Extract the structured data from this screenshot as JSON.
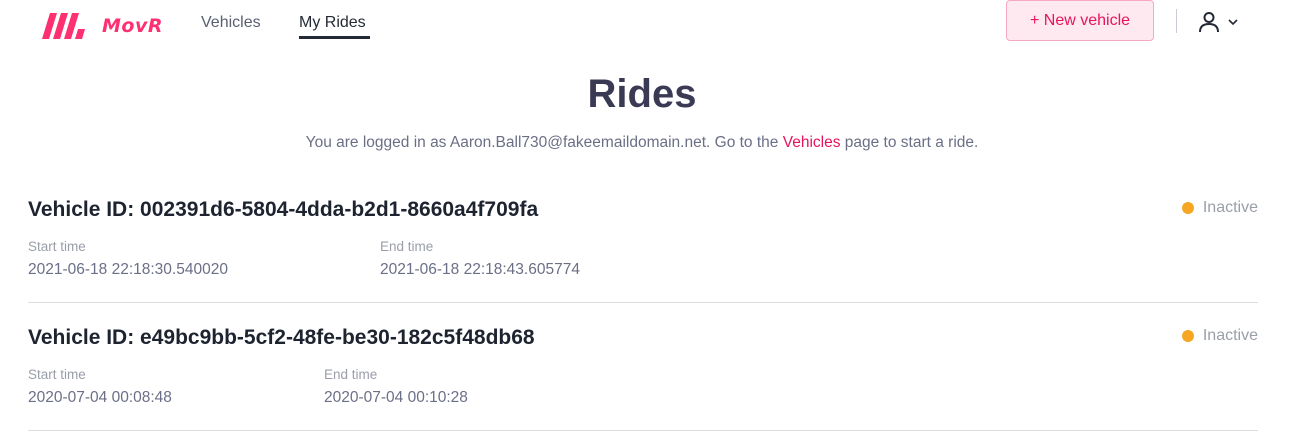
{
  "app": {
    "name": "MovR",
    "brand_color": "#ff3072"
  },
  "nav": {
    "vehicles_label": "Vehicles",
    "rides_label": "My Rides",
    "active": "My Rides"
  },
  "header": {
    "new_vehicle_label": "+ New vehicle",
    "user_icon": "user-icon",
    "menu_icon": "chevron-down-icon"
  },
  "page": {
    "title": "Rides",
    "subtitle_prefix": "You are logged in as Aaron.Ball730@fakeemaildomain.net. Go to the ",
    "subtitle_link": "Vehicles",
    "subtitle_suffix": " page to start a ride."
  },
  "rides": [
    {
      "title": "Vehicle ID: 002391d6-5804-4dda-b2d1-8660a4f709fa",
      "status": "Inactive",
      "status_color": "#f5a623",
      "start_label": "Start time",
      "start_value": "2021-06-18 22:18:30.540020",
      "end_label": "End time",
      "end_value": "2021-06-18 22:18:43.605774"
    },
    {
      "title": "Vehicle ID: e49bc9bb-5cf2-48fe-be30-182c5f48db68",
      "status": "Inactive",
      "status_color": "#f5a623",
      "start_label": "Start time",
      "start_value": "2020-07-04 00:08:48",
      "end_label": "End time",
      "end_value": "2020-07-04 00:10:28"
    }
  ]
}
